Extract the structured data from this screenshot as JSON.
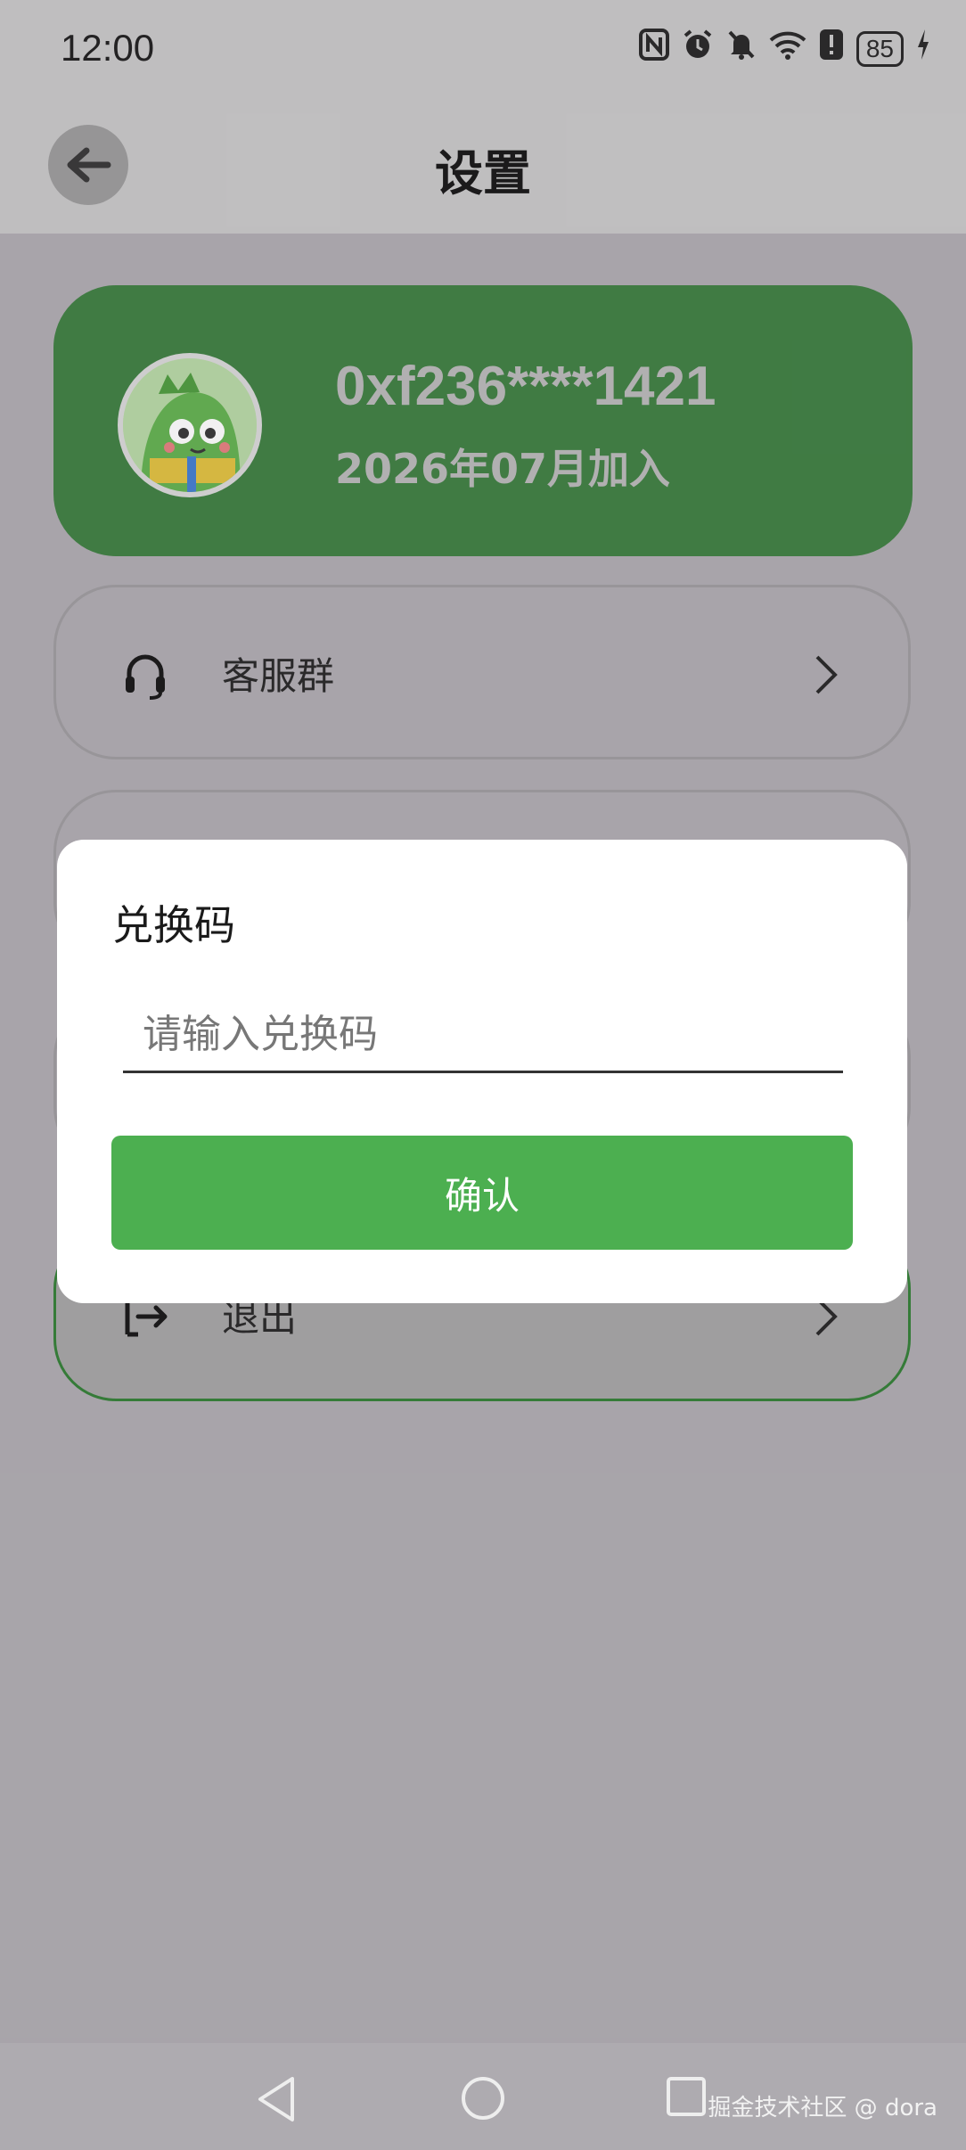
{
  "status_bar": {
    "time": "12:00",
    "battery": "85"
  },
  "app_bar": {
    "title": "设置"
  },
  "profile": {
    "user_id": "0xf236****1421",
    "join_date": "2026年07月加入"
  },
  "menu": [
    {
      "label": "客服群"
    },
    {
      "label": "退出"
    }
  ],
  "dialog": {
    "title": "兑换码",
    "input_placeholder": "请输入兑换码",
    "confirm_label": "确认"
  },
  "watermark": "掘金技术社区 @ dora",
  "colors": {
    "accent": "#4caf50",
    "card": "#3a7d3e",
    "exit_border": "#2e7d32"
  }
}
